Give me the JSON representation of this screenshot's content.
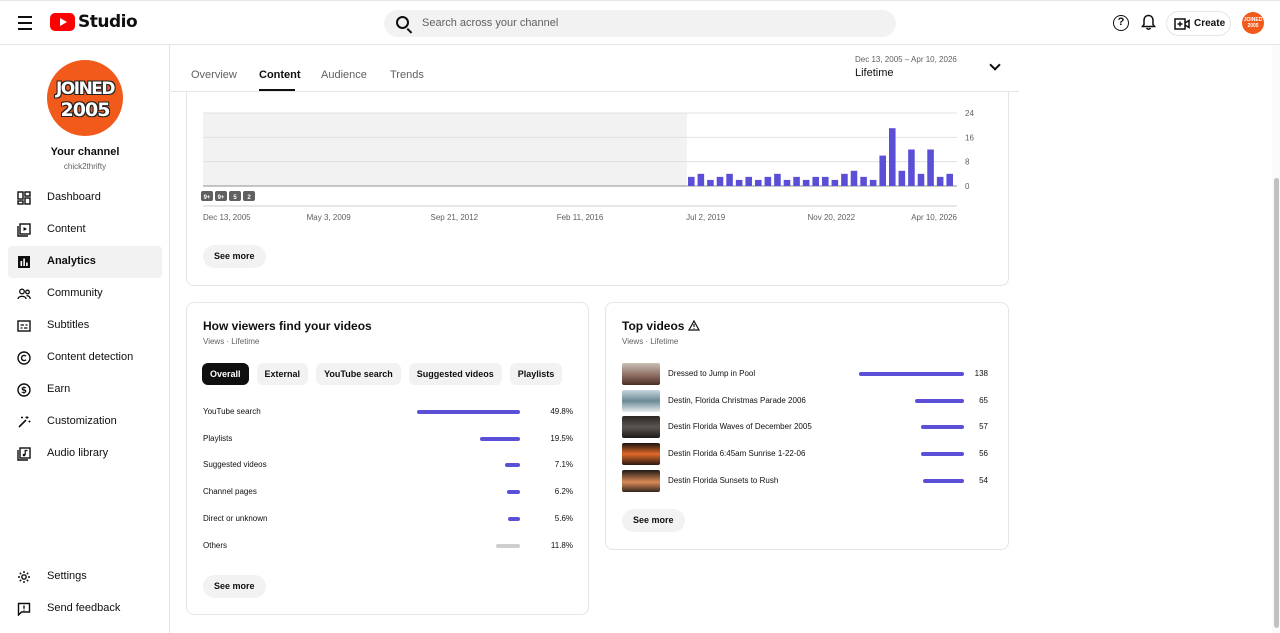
{
  "app": {
    "logo_text": "Studio",
    "search_placeholder": "Search across your channel",
    "create_label": "Create",
    "avatar_text": "JOINED 2005"
  },
  "channel": {
    "avatar_line1": "JOINED",
    "avatar_line2": "2005",
    "title": "Your channel",
    "handle": "chick2thrifty"
  },
  "sidebar": {
    "items": [
      {
        "label": "Dashboard",
        "icon": "dashboard-icon"
      },
      {
        "label": "Content",
        "icon": "content-icon"
      },
      {
        "label": "Analytics",
        "icon": "analytics-icon",
        "active": true
      },
      {
        "label": "Community",
        "icon": "community-icon"
      },
      {
        "label": "Subtitles",
        "icon": "subtitles-icon"
      },
      {
        "label": "Content detection",
        "icon": "copyright-icon"
      },
      {
        "label": "Earn",
        "icon": "dollar-icon"
      },
      {
        "label": "Customization",
        "icon": "magic-wand-icon"
      },
      {
        "label": "Audio library",
        "icon": "audio-library-icon"
      }
    ],
    "bottom": [
      {
        "label": "Settings",
        "icon": "gear-icon"
      },
      {
        "label": "Send feedback",
        "icon": "feedback-icon"
      }
    ]
  },
  "tabs": {
    "items": [
      "Overview",
      "Content",
      "Audience",
      "Trends"
    ],
    "active": "Content"
  },
  "date_filter": {
    "range": "Dec 13, 2005 – Apr 10, 2026",
    "label": "Lifetime"
  },
  "chart_data": {
    "type": "bar",
    "title": "",
    "xlabel": "",
    "ylabel": "",
    "ylim": [
      0,
      24
    ],
    "yticks": [
      "24",
      "16",
      "8",
      "0"
    ],
    "xticks": [
      "Dec 13, 2005",
      "May 3, 2009",
      "Sep 21, 2012",
      "Feb 11, 2016",
      "Jul 2, 2019",
      "Nov 20, 2022",
      "Apr 10, 2026"
    ],
    "markers": [
      "9+",
      "9+",
      "5",
      "2"
    ],
    "grid": true,
    "series_color": "#5b4fd8",
    "x": [
      "Jul 2019",
      "Oct 2019",
      "Jan 2020",
      "Apr 2020",
      "Jul 2020",
      "Oct 2020",
      "Jan 2021",
      "Apr 2021",
      "Jul 2021",
      "Oct 2021",
      "Jan 2022",
      "Apr 2022",
      "Jul 2022",
      "Oct 2022",
      "Jan 2023",
      "Apr 2023",
      "Jul 2023",
      "Oct 2023",
      "Jan 2024",
      "Apr 2024",
      "Jul 2024",
      "Oct 2024",
      "Jan 2025",
      "Apr 2025",
      "Jul 2025",
      "Oct 2025",
      "Jan 2026",
      "Apr 2026"
    ],
    "values": [
      3,
      4,
      2,
      3,
      4,
      2,
      3,
      2,
      3,
      4,
      2,
      3,
      2,
      3,
      3,
      2,
      4,
      5,
      3,
      2,
      10,
      19,
      5,
      12,
      4,
      12,
      3,
      4
    ]
  },
  "chart_card": {
    "see_more": "See more"
  },
  "traffic": {
    "title": "How viewers find your videos",
    "subtitle": "Views · Lifetime",
    "chips": [
      "Overall",
      "External",
      "YouTube search",
      "Suggested videos",
      "Playlists"
    ],
    "active_chip": "Overall",
    "rows": [
      {
        "label": "YouTube search",
        "pct": "49.8%",
        "value": 49.8
      },
      {
        "label": "Playlists",
        "pct": "19.5%",
        "value": 19.5
      },
      {
        "label": "Suggested videos",
        "pct": "7.1%",
        "value": 7.1
      },
      {
        "label": "Channel pages",
        "pct": "6.2%",
        "value": 6.2
      },
      {
        "label": "Direct or unknown",
        "pct": "5.6%",
        "value": 5.6
      },
      {
        "label": "Others",
        "pct": "11.8%",
        "value": 11.8,
        "muted": true
      }
    ],
    "see_more": "See more"
  },
  "top_videos": {
    "title": "Top videos",
    "subtitle": "Views · Lifetime",
    "rows": [
      {
        "title": "Dressed to Jump in Pool",
        "views": "138",
        "value": 138
      },
      {
        "title": "Destin, Florida Christmas Parade 2006",
        "views": "65",
        "value": 65
      },
      {
        "title": "Destin Florida Waves of December 2005",
        "views": "57",
        "value": 57
      },
      {
        "title": "Destin Florida 6:45am Sunrise 1-22-06",
        "views": "56",
        "value": 56
      },
      {
        "title": "Destin Florida Sunsets to Rush",
        "views": "54",
        "value": 54
      }
    ],
    "see_more": "See more"
  },
  "colors": {
    "accent": "#5b4fd8",
    "brand": "#ff0000",
    "avatar": "#f15a1a"
  }
}
